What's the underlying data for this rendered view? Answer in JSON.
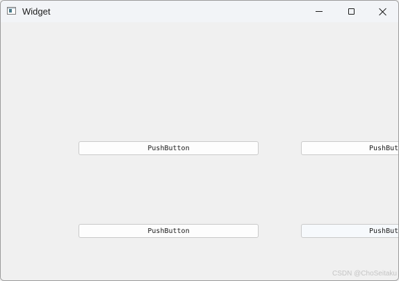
{
  "window": {
    "title": "Widget"
  },
  "buttons": [
    {
      "label": "PushButton"
    },
    {
      "label": "PushButton"
    },
    {
      "label": "PushButton"
    },
    {
      "label": "PushButton"
    }
  ],
  "watermark": "CSDN @ChoSeitaku"
}
